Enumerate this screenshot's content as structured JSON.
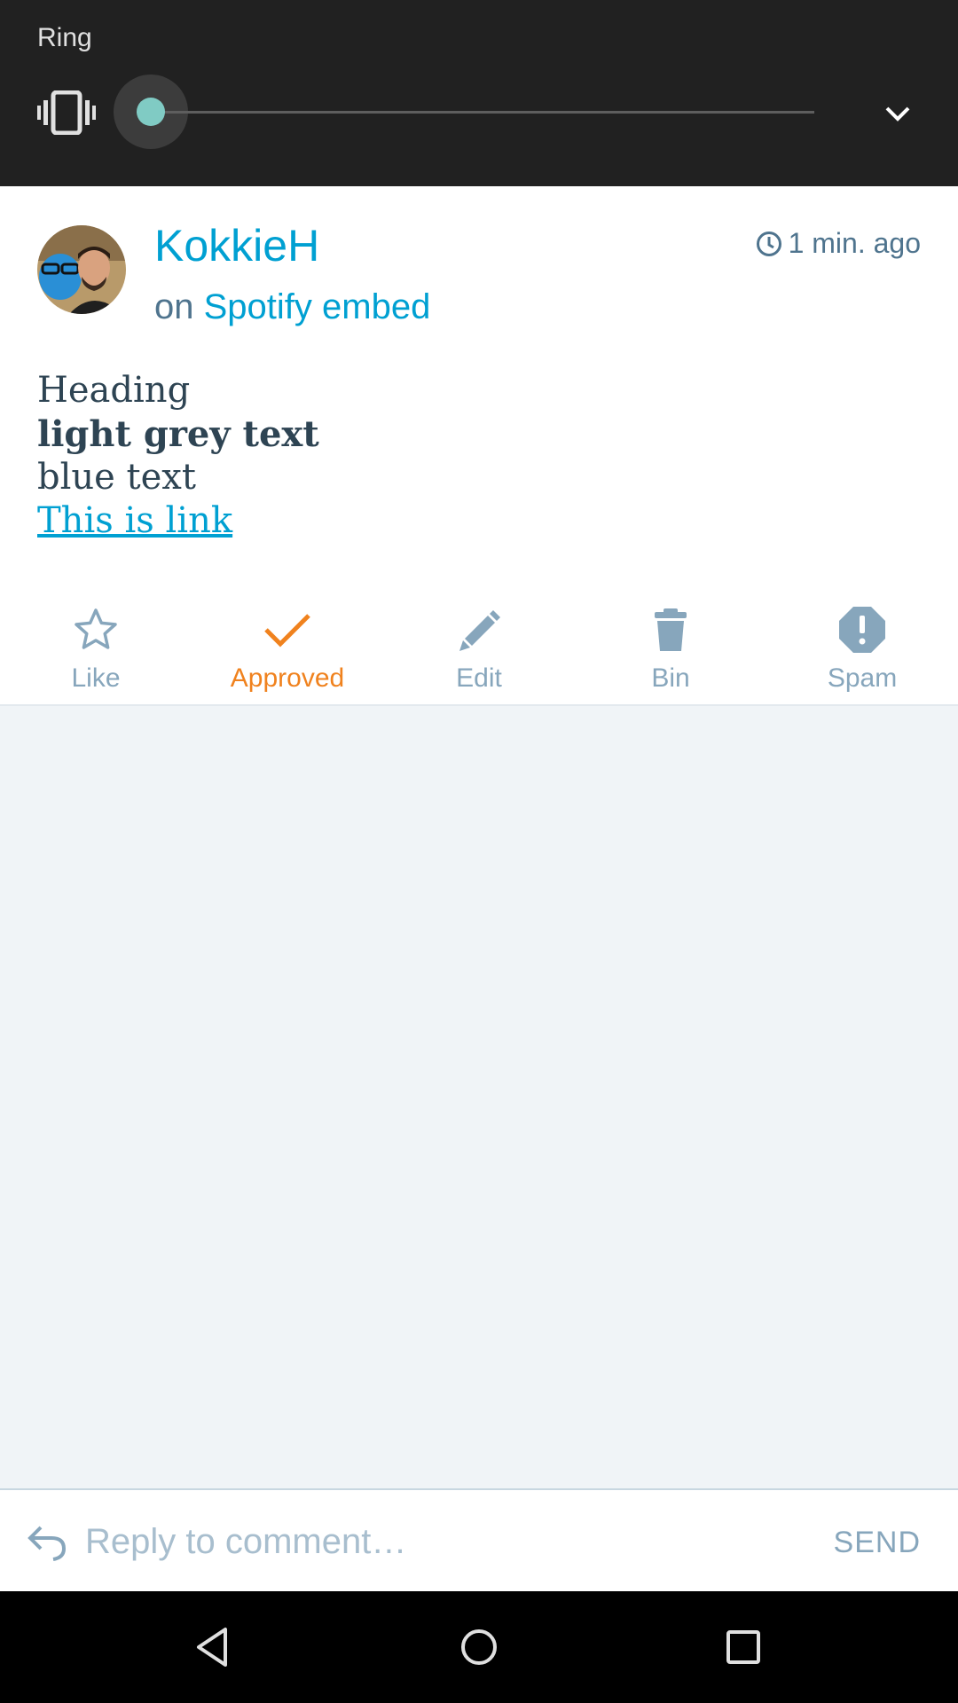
{
  "volume_panel": {
    "title": "Ring",
    "level": 0,
    "icons": {
      "mode": "vibrate-icon",
      "collapse": "chevron-down-icon"
    },
    "colors": {
      "background": "#212121",
      "thumb": "#80cbc4"
    }
  },
  "comment": {
    "author": "KokkieH",
    "on_prefix": "on",
    "post_title": "Spotify embed",
    "timestamp": "1 min. ago",
    "content": {
      "heading": "Heading",
      "bold_line": "light grey text",
      "plain_line": "blue text",
      "link_text": "This is link"
    }
  },
  "actions": [
    {
      "label": "Like",
      "icon": "star-icon",
      "active": false
    },
    {
      "label": "Approved",
      "icon": "checkmark-icon",
      "active": true
    },
    {
      "label": "Edit",
      "icon": "pencil-icon",
      "active": false
    },
    {
      "label": "Bin",
      "icon": "trash-icon",
      "active": false
    },
    {
      "label": "Spam",
      "icon": "spam-icon",
      "active": false
    }
  ],
  "reply": {
    "placeholder": "Reply to comment…",
    "send_label": "SEND"
  },
  "colors": {
    "accent": "#00a0d2",
    "approved": "#f0821e",
    "muted": "#87a6bc",
    "text": "#2e4453",
    "background": "#f0f4f7"
  }
}
